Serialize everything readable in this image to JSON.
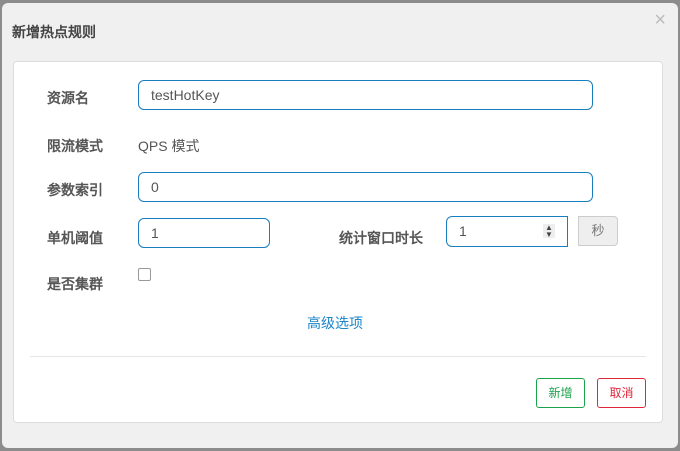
{
  "dialog": {
    "title": "新增热点规则",
    "close": "×"
  },
  "form": {
    "resource_label": "资源名",
    "resource_value": "testHotKey",
    "mode_label": "限流模式",
    "mode_value": "QPS 模式",
    "param_index_label": "参数索引",
    "param_index_value": "0",
    "threshold_label": "单机阈值",
    "threshold_value": "1",
    "window_label": "统计窗口时长",
    "window_value": "1",
    "window_unit": "秒",
    "cluster_label": "是否集群",
    "cluster_checked": false,
    "advanced_link": "高级选项"
  },
  "buttons": {
    "add": "新增",
    "cancel": "取消"
  },
  "colors": {
    "accent": "#1a7dbf",
    "add": "#1aa34a",
    "cancel": "#e0263a"
  }
}
